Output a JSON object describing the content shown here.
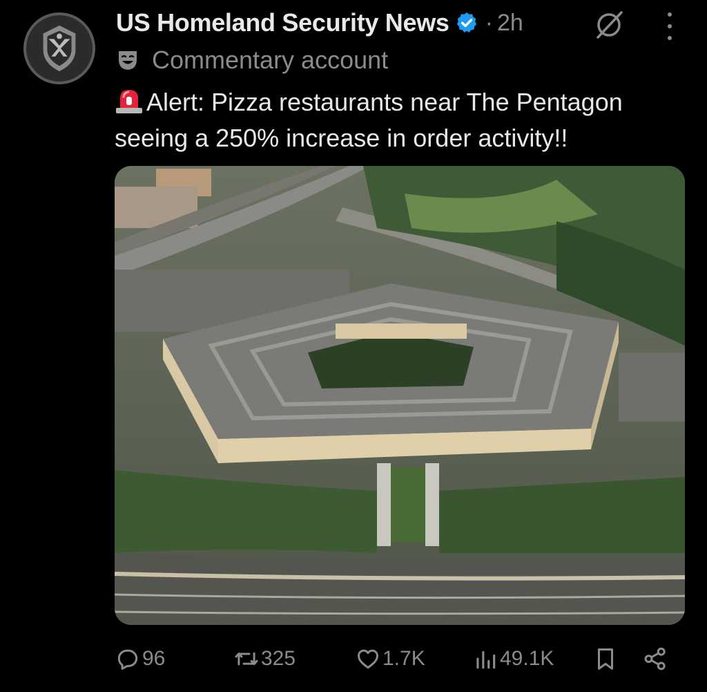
{
  "tweet": {
    "author_name": "US Homeland Security News",
    "separator": "·",
    "time": "2h",
    "label": "Commentary account",
    "text": "Alert: Pizza restaurants near The Pentagon seeing a 250% increase in order activity!!",
    "image_alt": "Aerial view of the Pentagon"
  },
  "actions": {
    "replies": "96",
    "reposts": "325",
    "likes": "1.7K",
    "views": "49.1K"
  },
  "icons": {
    "avatar": "eagle-shield-logo",
    "verified": "verified-badge-icon",
    "grok": "grok-icon",
    "more": "more-options-icon",
    "label": "theater-mask-icon",
    "siren": "siren-emoji",
    "reply": "reply-icon",
    "repost": "repost-icon",
    "like": "heart-icon",
    "views": "views-icon",
    "bookmark": "bookmark-icon",
    "share": "share-icon"
  },
  "colors": {
    "background": "#000000",
    "text_primary": "#e7e9ea",
    "text_secondary": "#8b8b8b",
    "verified": "#1d9bf0"
  }
}
